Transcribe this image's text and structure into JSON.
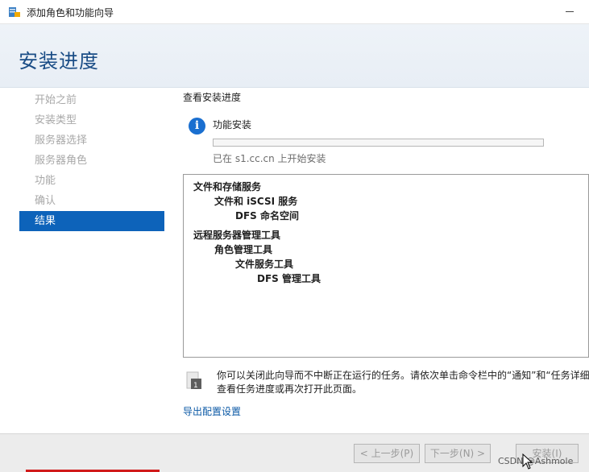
{
  "window": {
    "title": "添加角色和功能向导"
  },
  "page": {
    "title": "安装进度"
  },
  "nav": {
    "items": [
      {
        "label": "开始之前",
        "active": false
      },
      {
        "label": "安装类型",
        "active": false
      },
      {
        "label": "服务器选择",
        "active": false
      },
      {
        "label": "服务器角色",
        "active": false
      },
      {
        "label": "功能",
        "active": false
      },
      {
        "label": "确认",
        "active": false
      },
      {
        "label": "结果",
        "active": true
      }
    ]
  },
  "content": {
    "section_label": "查看安装进度",
    "install_label": "功能安装",
    "progress_fraction": 0,
    "started_text": "已在 s1.cc.cn 上开始安装",
    "tree": [
      {
        "text": "文件和存储服务",
        "level": 0
      },
      {
        "text": "文件和 iSCSI 服务",
        "level": 1
      },
      {
        "text": "DFS 命名空间",
        "level": 2
      },
      {
        "text": "远程服务器管理工具",
        "level": 0
      },
      {
        "text": "角色管理工具",
        "level": 1
      },
      {
        "text": "文件服务工具",
        "level": 2
      },
      {
        "text": "DFS 管理工具",
        "level": 3
      }
    ],
    "note_line1": "你可以关闭此向导而不中断正在运行的任务。请依次单击命令栏中的“通知”和“任务详细信息”，以",
    "note_line2": "查看任务进度或再次打开此页面。",
    "export_link": "导出配置设置"
  },
  "footer": {
    "prev_button": "< 上一步(P)",
    "next_button": "下一步(N) >",
    "install_button": "安装(I)",
    "watermark": "CSDN @Ashmole"
  },
  "colors": {
    "accent": "#0d63ba",
    "title": "#1a4d86",
    "progress": "#06b025",
    "link": "#0c5aa6"
  }
}
